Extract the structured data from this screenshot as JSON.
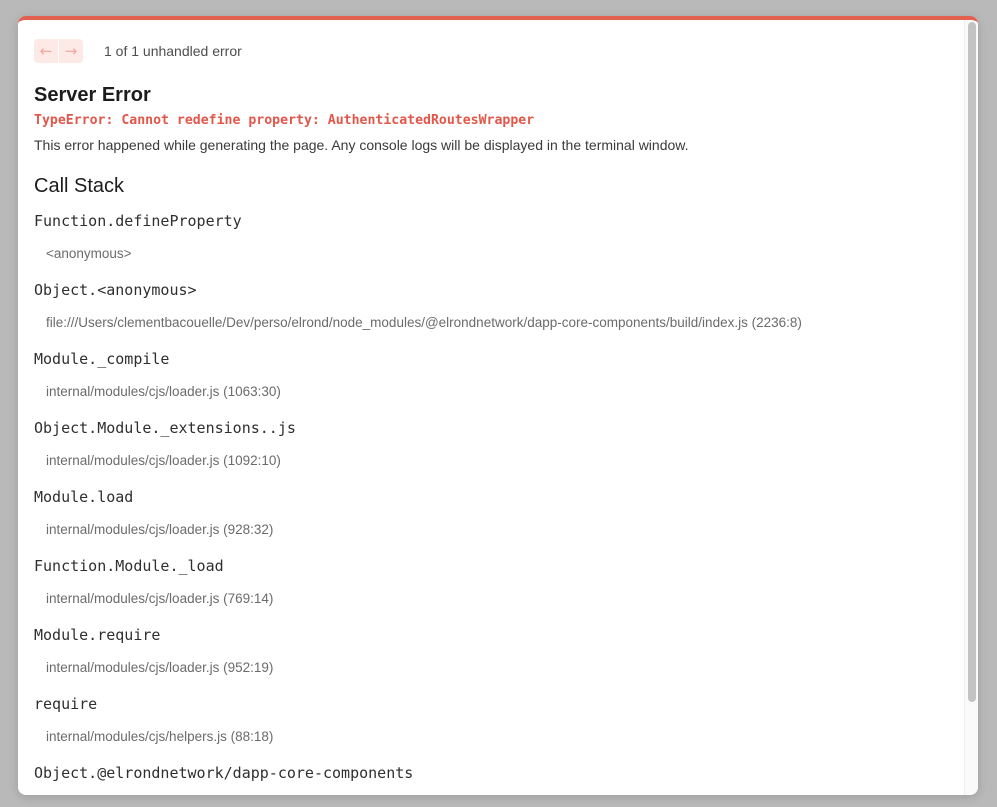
{
  "nav": {
    "prev_icon": "←",
    "next_icon": "→",
    "count_text": "1 of 1 unhandled error"
  },
  "error": {
    "title": "Server Error",
    "message": "TypeError: Cannot redefine property: AuthenticatedRoutesWrapper",
    "description": "This error happened while generating the page. Any console logs will be displayed in the terminal window."
  },
  "callstack": {
    "heading": "Call Stack",
    "frames": [
      {
        "fn": "Function.defineProperty",
        "loc": "<anonymous>"
      },
      {
        "fn": "Object.<anonymous>",
        "loc": "file:///Users/clementbacouelle/Dev/perso/elrond/node_modules/@elrondnetwork/dapp-core-components/build/index.js (2236:8)"
      },
      {
        "fn": "Module._compile",
        "loc": "internal/modules/cjs/loader.js (1063:30)"
      },
      {
        "fn": "Object.Module._extensions..js",
        "loc": "internal/modules/cjs/loader.js (1092:10)"
      },
      {
        "fn": "Module.load",
        "loc": "internal/modules/cjs/loader.js (928:32)"
      },
      {
        "fn": "Function.Module._load",
        "loc": "internal/modules/cjs/loader.js (769:14)"
      },
      {
        "fn": "Module.require",
        "loc": "internal/modules/cjs/loader.js (952:19)"
      },
      {
        "fn": "require",
        "loc": "internal/modules/cjs/helpers.js (88:18)"
      },
      {
        "fn": "Object.@elrondnetwork/dapp-core-components",
        "loc": ""
      }
    ]
  },
  "colors": {
    "accent": "#e3604f",
    "error_text": "#e3564a",
    "nav_bg": "#fde9e6"
  }
}
